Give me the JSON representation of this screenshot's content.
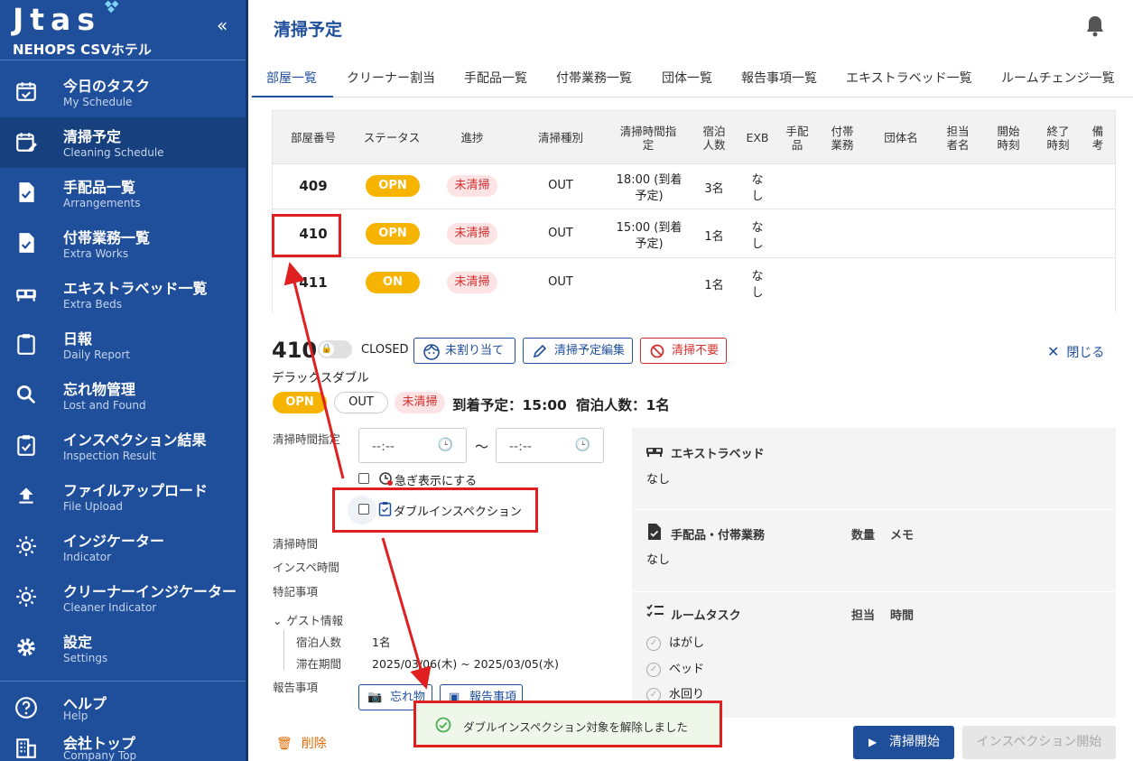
{
  "app": {
    "logo": "Jtas",
    "hotel_name": "NEHOPS CSVホテル"
  },
  "sidebar": {
    "items": [
      {
        "label": "今日のタスク",
        "sub": "My Schedule",
        "icon": "calendar-check-icon"
      },
      {
        "label": "清掃予定",
        "sub": "Cleaning Schedule",
        "icon": "calendar-edit-icon"
      },
      {
        "label": "手配品一覧",
        "sub": "Arrangements",
        "icon": "document-check-icon"
      },
      {
        "label": "付帯業務一覧",
        "sub": "Extra Works",
        "icon": "document-check-icon"
      },
      {
        "label": "エキストラベッド一覧",
        "sub": "Extra Beds",
        "icon": "bed-icon"
      },
      {
        "label": "日報",
        "sub": "Daily Report",
        "icon": "clipboard-icon"
      },
      {
        "label": "忘れ物管理",
        "sub": "Lost and Found",
        "icon": "search-icon"
      },
      {
        "label": "インスペクション結果",
        "sub": "Inspection Result",
        "icon": "clipboard-check-icon"
      },
      {
        "label": "ファイルアップロード",
        "sub": "File Upload",
        "icon": "upload-icon"
      },
      {
        "label": "インジケーター",
        "sub": "Indicator",
        "icon": "sun-icon"
      },
      {
        "label": "クリーナーインジケーター",
        "sub": "Cleaner Indicator",
        "icon": "sun-icon"
      },
      {
        "label": "設定",
        "sub": "Settings",
        "icon": "gear-icon"
      }
    ],
    "bottom": [
      {
        "label": "ヘルプ",
        "sub": "Help",
        "icon": "help-icon"
      },
      {
        "label": "会社トップ",
        "sub": "Company Top",
        "icon": "building-icon"
      }
    ]
  },
  "header": {
    "title": "清掃予定"
  },
  "tabs": [
    "部屋一覧",
    "クリーナー割当",
    "手配品一覧",
    "付帯業務一覧",
    "団体一覧",
    "報告事項一覧",
    "エキストラベッド一覧",
    "ルームチェンジ一覧"
  ],
  "table": {
    "headers": [
      "部屋番号",
      "ステータス",
      "進捗",
      "清掃種別",
      "清掃時間指定",
      "宿泊人数",
      "EXB",
      "手配品",
      "付帯業務",
      "団体名",
      "担当者名",
      "開始時刻",
      "終了時刻",
      "備考"
    ],
    "rows": [
      {
        "room": "409",
        "status": "OPN",
        "progress": "未清掃",
        "type": "OUT",
        "time_l1": "18:00 (到着",
        "time_l2": "予定)",
        "guests": "3名",
        "exb_l1": "な",
        "exb_l2": "し"
      },
      {
        "room": "410",
        "status": "OPN",
        "progress": "未清掃",
        "type": "OUT",
        "time_l1": "15:00 (到着",
        "time_l2": "予定)",
        "guests": "1名",
        "exb_l1": "な",
        "exb_l2": "し"
      },
      {
        "room": "411",
        "status": "ON",
        "progress": "未清掃",
        "type": "OUT",
        "time_l1": "",
        "time_l2": "",
        "guests": "1名",
        "exb_l1": "な",
        "exb_l2": "し"
      }
    ]
  },
  "detail": {
    "room": "410",
    "lock_state": "CLOSED",
    "btn_unassigned": "未割り当て",
    "btn_edit": "清掃予定編集",
    "btn_no_clean": "清掃不要",
    "close": "閉じる",
    "room_type": "デラックスダブル",
    "status": "OPN",
    "type": "OUT",
    "progress": "未清掃",
    "arrival": "到着予定：15:00",
    "guests": "宿泊人数：1名",
    "time_spec_label": "清掃時間指定",
    "time_from": "--:--",
    "time_to": "--:--",
    "tilde": "〜",
    "urgent_label": "急ぎ表示にする",
    "double_insp_label": "ダブルインスペクション",
    "clean_time_label": "清掃時間",
    "insp_time_label": "インスペ時間",
    "notes_label": "特記事項",
    "guest_info_label": "ゲスト情報",
    "guest_count_label": "宿泊人数",
    "guest_count": "1名",
    "stay_label": "滞在期間",
    "stay": "2025/03/06(木) ~ 2025/03/05(水)",
    "report_label": "報告事項",
    "btn_lost": "忘れ物",
    "btn_report": "報告事項",
    "delete": "削除",
    "start_clean": "清掃開始",
    "start_insp": "インスペクション開始"
  },
  "panel": {
    "extra_bed_title": "エキストラベッド",
    "extra_bed_value": "なし",
    "arr_title": "手配品・付帯業務",
    "arr_qty": "数量",
    "arr_memo": "メモ",
    "arr_value": "なし",
    "task_title": "ルームタスク",
    "task_assignee": "担当",
    "task_time": "時間",
    "tasks": [
      "はがし",
      "ベッド",
      "水回り"
    ]
  },
  "toast": {
    "message": "ダブルインスペクション対象を解除しました"
  },
  "colors": {
    "primary": "#1f4e9b",
    "warning": "#f6b400",
    "danger": "#d32f2f",
    "annotation": "#e02020"
  }
}
